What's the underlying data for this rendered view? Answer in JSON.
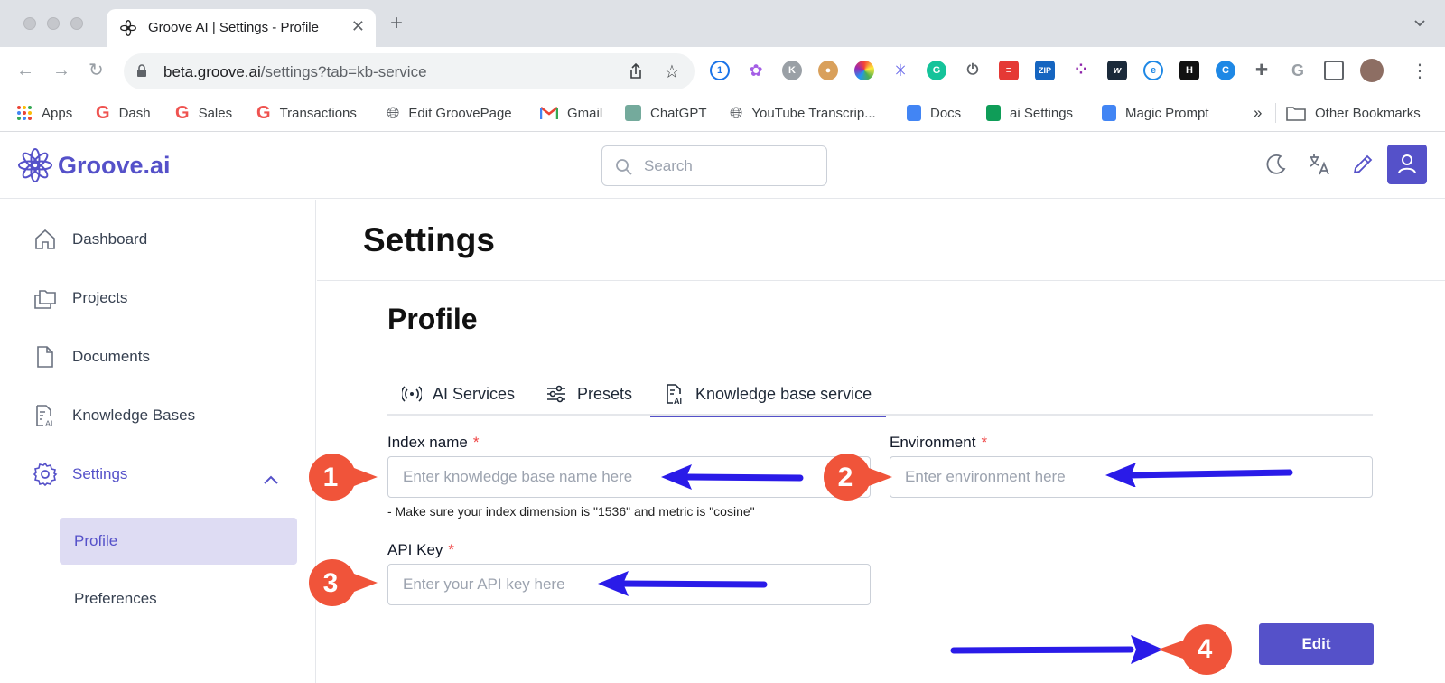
{
  "browser": {
    "tab_title": "Groove AI | Settings - Profile",
    "url_host": "beta.groove.ai",
    "url_path": "/settings?tab=kb-service",
    "bookmarks": [
      {
        "label": "Apps",
        "icon": "apps-grid-icon"
      },
      {
        "label": "Dash",
        "icon": "groove-icon"
      },
      {
        "label": "Sales",
        "icon": "groove-icon"
      },
      {
        "label": "Transactions",
        "icon": "groove-icon"
      },
      {
        "label": "Edit GroovePage",
        "icon": "globe-icon"
      },
      {
        "label": "Gmail",
        "icon": "gmail-icon"
      },
      {
        "label": "ChatGPT",
        "icon": "chatgpt-icon"
      },
      {
        "label": "YouTube Transcrip...",
        "icon": "globe-icon"
      },
      {
        "label": "Docs",
        "icon": "docs-icon"
      },
      {
        "label": "ai Settings",
        "icon": "sheets-icon"
      },
      {
        "label": "Magic Prompt",
        "icon": "docs-icon"
      }
    ],
    "other_bookmarks": "Other Bookmarks",
    "overflow": "»"
  },
  "header": {
    "logo_text": "Groove.ai",
    "search_placeholder": "Search",
    "brand_color": "#5551c9"
  },
  "sidebar": {
    "items": [
      {
        "label": "Dashboard",
        "icon": "home-icon"
      },
      {
        "label": "Projects",
        "icon": "folders-icon"
      },
      {
        "label": "Documents",
        "icon": "document-icon"
      },
      {
        "label": "Knowledge Bases",
        "icon": "knowledge-base-icon"
      },
      {
        "label": "Settings",
        "icon": "gear-icon"
      }
    ],
    "sub_items": [
      {
        "label": "Profile",
        "active": true
      },
      {
        "label": "Preferences",
        "active": false
      }
    ]
  },
  "main": {
    "page_title": "Settings",
    "section_title": "Profile",
    "tabs": [
      {
        "label": "AI Services",
        "icon": "broadcast-icon"
      },
      {
        "label": "Presets",
        "icon": "sliders-icon"
      },
      {
        "label": "Knowledge base service",
        "icon": "ai-document-icon",
        "active": true
      }
    ],
    "form": {
      "index_name": {
        "label": "Index name",
        "required": "*",
        "value": "",
        "placeholder": "Enter knowledge base name here"
      },
      "environment": {
        "label": "Environment",
        "required": "*",
        "value": "",
        "placeholder": "Enter environment here"
      },
      "api_key": {
        "label": "API Key",
        "required": "*",
        "value": "",
        "placeholder": "Enter your API key here"
      },
      "hint": "- Make sure your index dimension is \"1536\" and metric is \"cosine\"",
      "edit_label": "Edit"
    }
  },
  "annotations": {
    "callouts": [
      "1",
      "2",
      "3",
      "4"
    ],
    "callout_color": "#f0543a",
    "arrow_color": "#2a1be8"
  }
}
